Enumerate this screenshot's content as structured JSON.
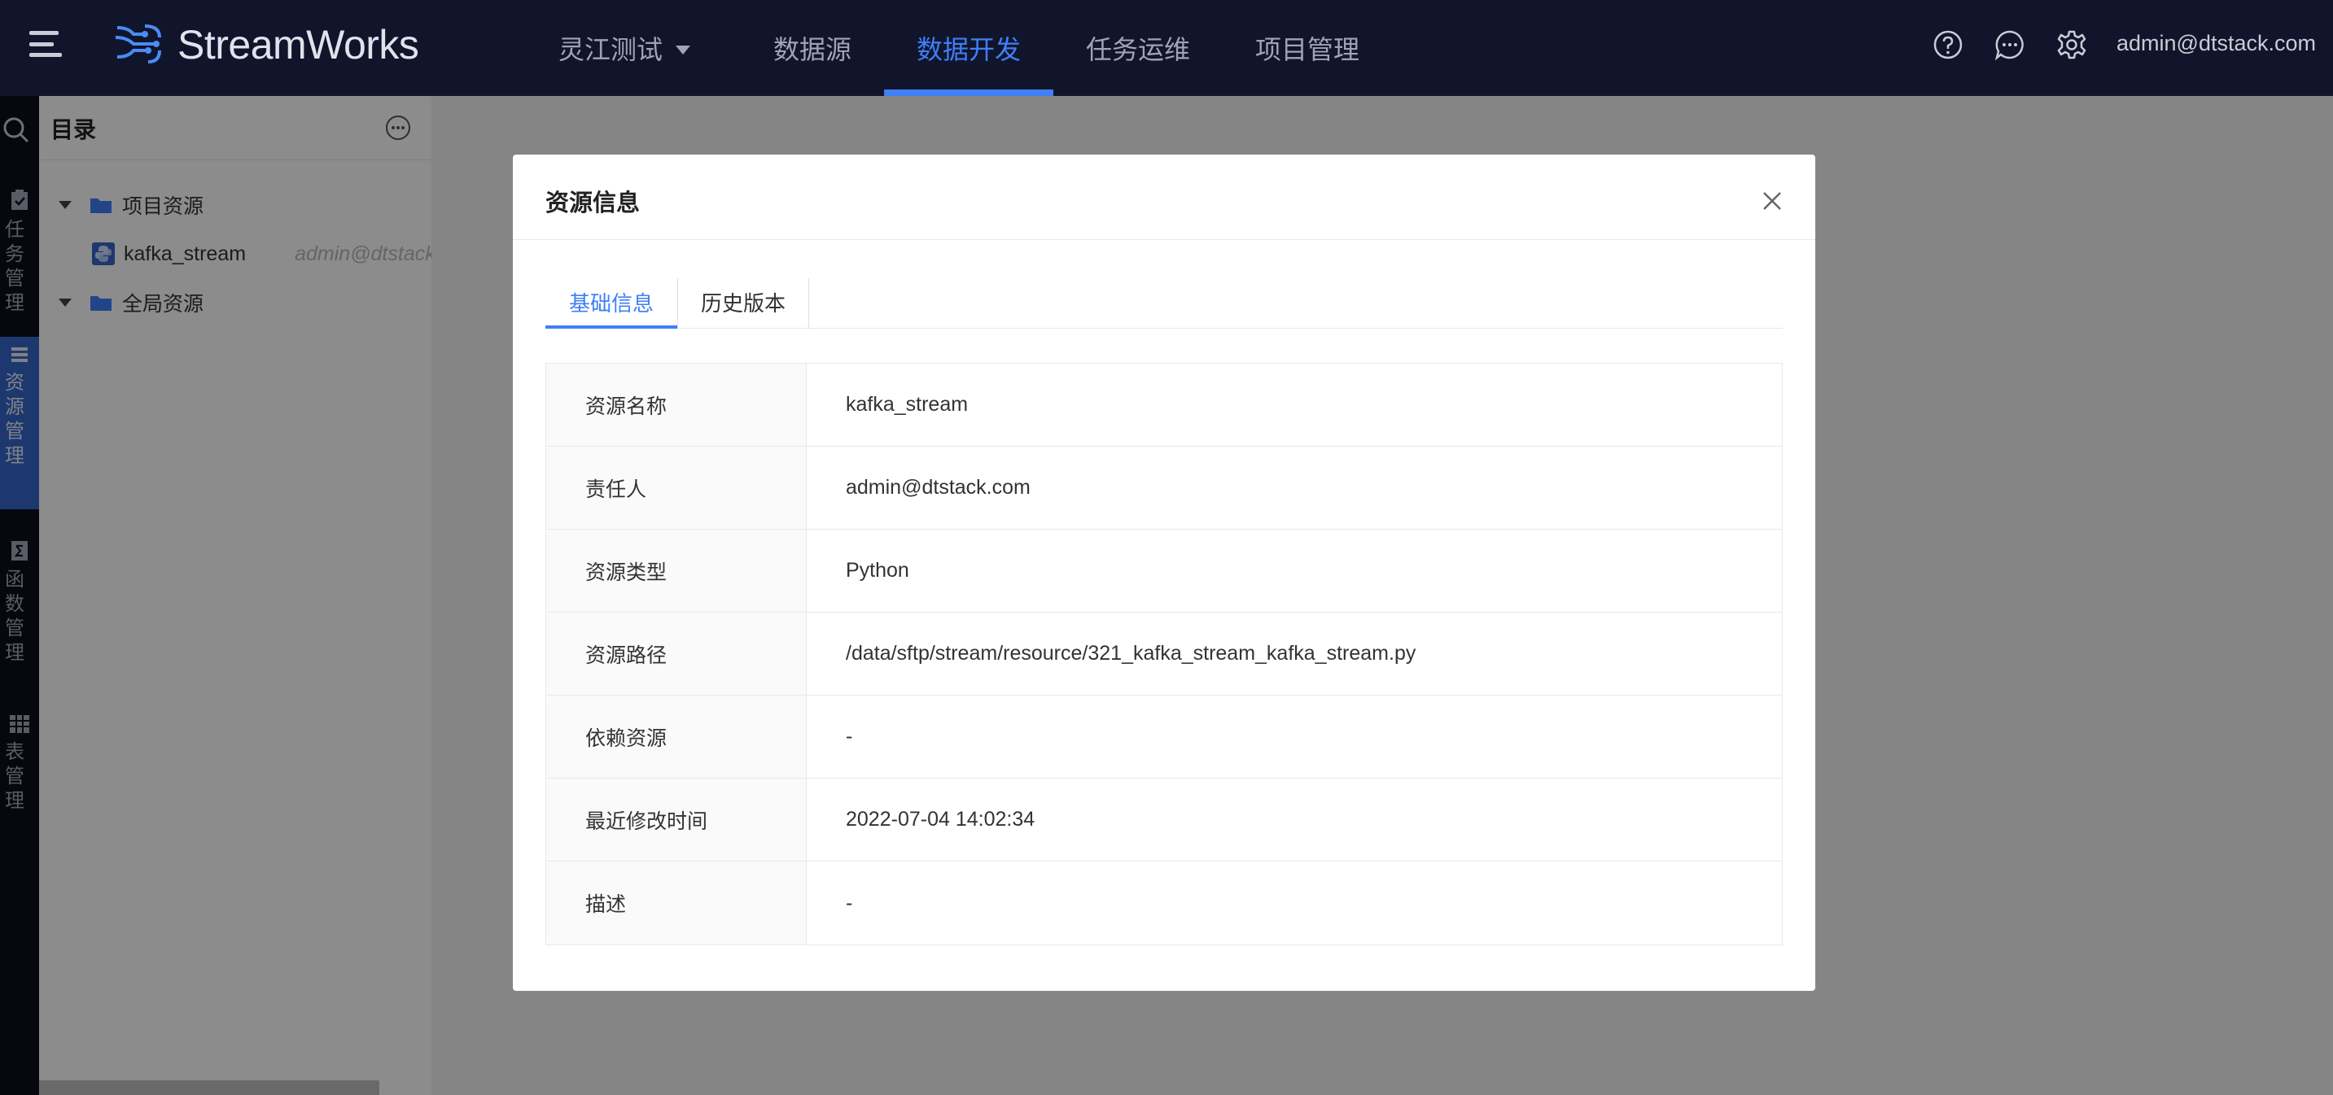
{
  "header": {
    "app_name": "StreamWorks",
    "project_selector": "灵江测试",
    "nav": [
      "数据源",
      "数据开发",
      "任务运维",
      "项目管理"
    ],
    "active_nav": "数据开发",
    "user": "admin@dtstack.com",
    "icons": [
      "help-icon",
      "message-icon",
      "settings-icon"
    ]
  },
  "rail": {
    "items": [
      {
        "label": "任务管理",
        "icon": "task-icon"
      },
      {
        "label": "资源管理",
        "icon": "resource-icon",
        "active": true
      },
      {
        "label": "函数管理",
        "icon": "function-icon"
      },
      {
        "label": "表管理",
        "icon": "table-icon"
      }
    ]
  },
  "directory": {
    "title": "目录",
    "tree": {
      "project_folder": "项目资源",
      "file": {
        "name": "kafka_stream",
        "owner": "admin@dtstack.com"
      },
      "global_folder": "全局资源"
    }
  },
  "modal": {
    "title": "资源信息",
    "tabs": [
      "基础信息",
      "历史版本"
    ],
    "active_tab": "基础信息",
    "rows": [
      {
        "label": "资源名称",
        "value": "kafka_stream"
      },
      {
        "label": "责任人",
        "value": "admin@dtstack.com"
      },
      {
        "label": "资源类型",
        "value": "Python"
      },
      {
        "label": "资源路径",
        "value": "/data/sftp/stream/resource/321_kafka_stream_kafka_stream.py"
      },
      {
        "label": "依赖资源",
        "value": "-"
      },
      {
        "label": "最近修改时间",
        "value": "2022-07-04 14:02:34"
      },
      {
        "label": "描述",
        "value": "-"
      }
    ]
  }
}
